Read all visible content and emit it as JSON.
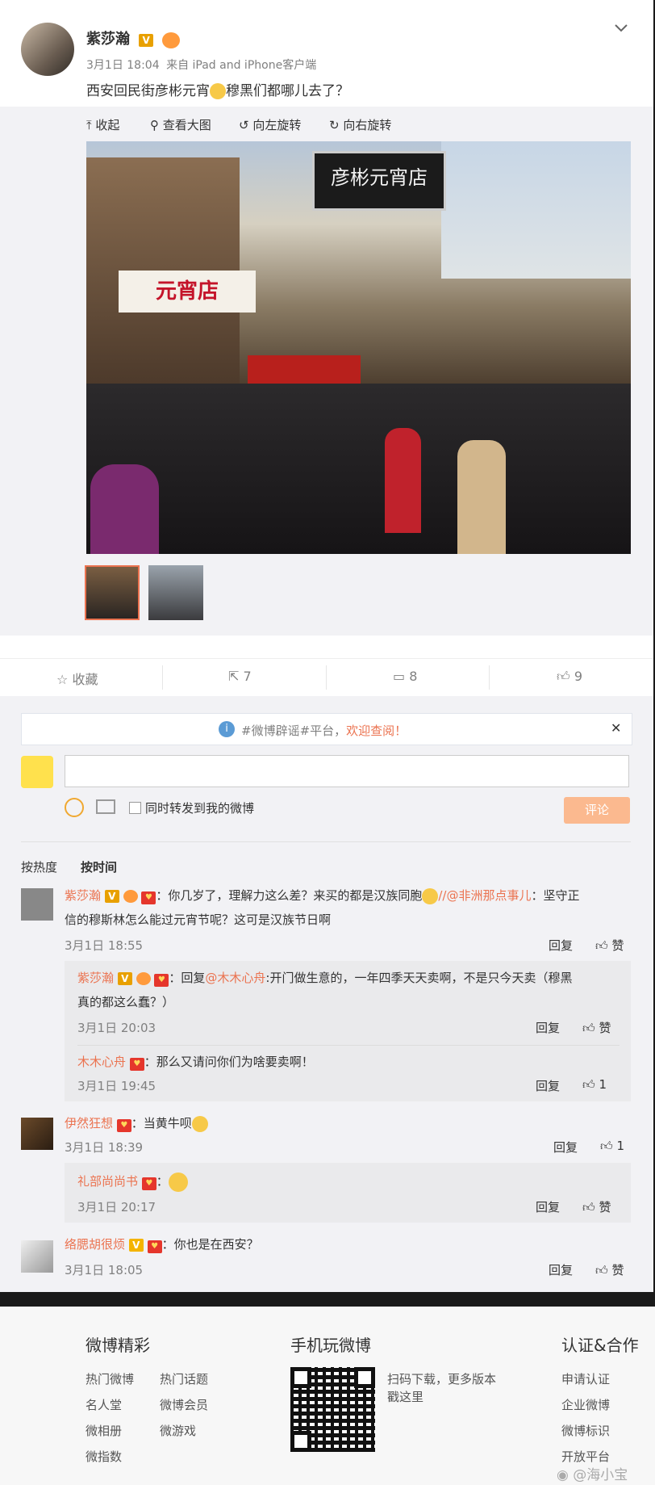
{
  "post": {
    "author": "紫莎瀚",
    "time": "3月1日 18:04",
    "source": "来自 iPad and iPhone客户端",
    "text_a": "西安回民街彦彬元宵",
    "text_b": "穆黑们都哪儿去了？"
  },
  "media_toolbar": {
    "collapse": "收起",
    "view_large": "查看大图",
    "rotate_left": "向左旋转",
    "rotate_right": "向右旋转"
  },
  "photo_signs": {
    "main_sign": "彦彬元宵店",
    "shop_sign": "元宵店"
  },
  "actions": {
    "favorite": "收藏",
    "share": "7",
    "comment": "8",
    "like": "9"
  },
  "notice": {
    "prefix": "#微博辟谣#平台，",
    "highlight": "欢迎查阅！"
  },
  "composer": {
    "repost_label": "同时转发到我的微博",
    "submit": "评论"
  },
  "sort": {
    "hot": "按热度",
    "time": "按时间"
  },
  "comments": [
    {
      "name": "紫莎瀚",
      "text_a": "：你几岁了，理解力这么差？来买的都是汉族同胞",
      "mention": "//@非洲那点事儿",
      "text_b": "：坚守正",
      "text_line2": "信的穆斯林怎么能过元宵节呢？这可是汉族节日啊",
      "time": "3月1日 18:55",
      "reply": "回复",
      "like": "赞",
      "subs": [
        {
          "name": "紫莎瀚",
          "text_a": "：回复",
          "mention": "@木木心舟",
          "text_b": ":开门做生意的，一年四季天天卖啊，不是只今天卖（穆黑",
          "text_line2": "真的都这么蠢？）",
          "time": "3月1日 20:03",
          "reply": "回复",
          "like": "赞"
        },
        {
          "name": "木木心舟",
          "text_a": "：那么又请问你们为啥要卖啊！",
          "time": "3月1日 19:45",
          "reply": "回复",
          "like": "1"
        }
      ]
    },
    {
      "name": "伊然狂想",
      "text_a": "：当黄牛呗",
      "time": "3月1日 18:39",
      "reply": "回复",
      "like": "1",
      "subs": [
        {
          "name": "礼部尚尚书",
          "text_a": "：",
          "time": "3月1日 20:17",
          "reply": "回复",
          "like": "赞"
        }
      ]
    },
    {
      "name": "络腮胡很烦",
      "text_a": "：你也是在西安？",
      "time": "3月1日 18:05",
      "reply": "回复",
      "like": "赞"
    }
  ],
  "footer": {
    "col1": {
      "title": "微博精彩",
      "links": [
        "热门微博",
        "热门话题",
        "名人堂",
        "微博会员",
        "微相册",
        "微游戏",
        "微指数"
      ]
    },
    "col2": {
      "title": "手机玩微博",
      "desc_line1": "扫码下载，更多版本",
      "desc_line2": "戳这里"
    },
    "col3": {
      "title": "认证&合作",
      "links": [
        "申请认证",
        "企业微博",
        "微博标识",
        "开放平台"
      ]
    },
    "watermark": "@海小宝"
  }
}
